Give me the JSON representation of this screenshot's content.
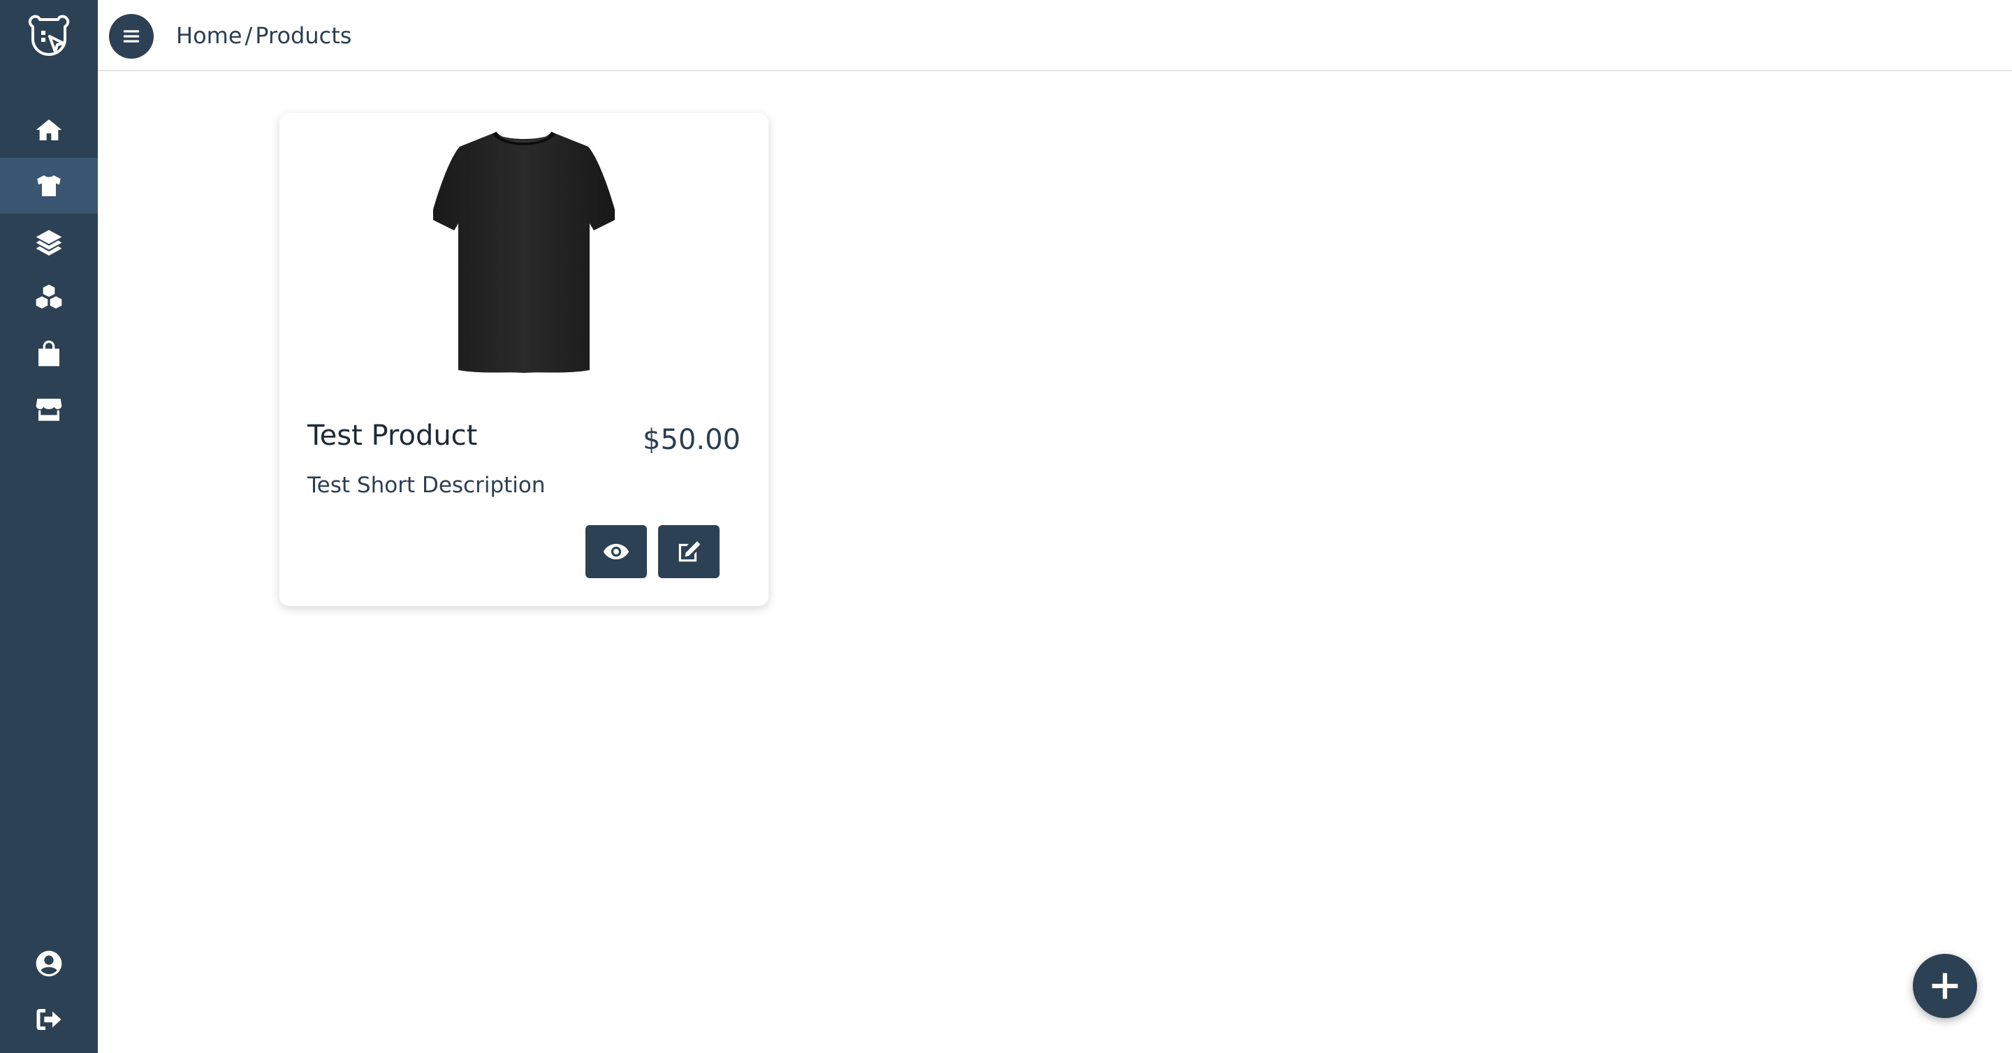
{
  "colors": {
    "sidebar_bg": "#2d4154",
    "sidebar_active": "#3a5571",
    "accent": "#2d4154",
    "text": "#2c3e50"
  },
  "sidebar": {
    "logo_icon": "bear-cursor-logo",
    "items": [
      {
        "icon": "home-icon",
        "active": false
      },
      {
        "icon": "tshirt-icon",
        "active": true
      },
      {
        "icon": "layers-icon",
        "active": false
      },
      {
        "icon": "cubes-icon",
        "active": false
      },
      {
        "icon": "shopping-bag-icon",
        "active": false
      },
      {
        "icon": "store-icon",
        "active": false
      }
    ],
    "bottom_items": [
      {
        "icon": "user-circle-icon"
      },
      {
        "icon": "sign-out-icon"
      }
    ]
  },
  "header": {
    "menu_icon": "hamburger-icon",
    "breadcrumb": {
      "home": "Home",
      "separator": "/",
      "current": "Products"
    }
  },
  "products": [
    {
      "title": "Test Product",
      "price": "$50.00",
      "short_description": "Test Short Description",
      "image_icon": "black-tshirt-image",
      "actions": [
        {
          "icon": "eye-icon"
        },
        {
          "icon": "edit-icon"
        }
      ]
    }
  ],
  "fab": {
    "icon": "plus-icon"
  }
}
